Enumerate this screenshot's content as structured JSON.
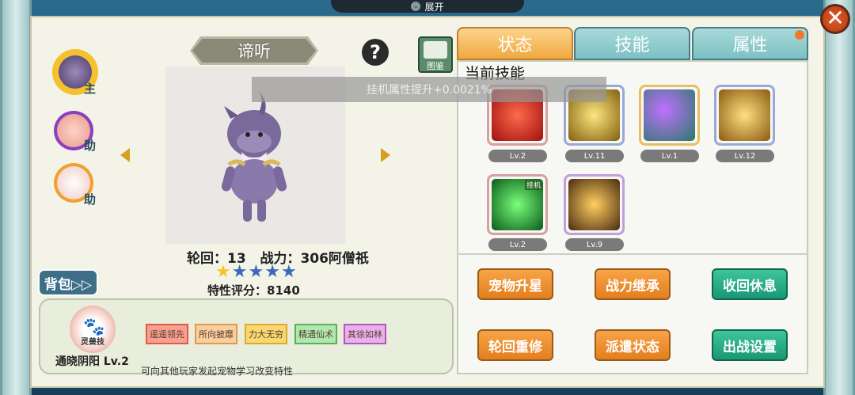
{
  "top_bar": {
    "expand_label": "展开"
  },
  "pet": {
    "name": "谛听",
    "reincarnation_label": "轮回：",
    "reincarnation": "13",
    "power_label": "战力：",
    "power": "306阿僧祇",
    "stars": 5,
    "trait_label": "特性评分：",
    "trait_score": "8140"
  },
  "team": [
    {
      "tag": "主",
      "role": "main"
    },
    {
      "tag": "助",
      "role": "assist"
    },
    {
      "tag": "助",
      "role": "assist"
    }
  ],
  "bag_label": "背包▷▷",
  "trait_box": {
    "emblem_text": "灵兽技",
    "pet_title": "通晓阴阳 Lv.2",
    "chips": [
      "遥遥领先",
      "所向披靡",
      "力大无穷",
      "精通仙术",
      "其徐如林"
    ],
    "chip_colors": [
      "#f07060",
      "#f4b070",
      "#f7c840",
      "#7ad07a",
      "#d07ad8"
    ],
    "description": "可向其他玩家发起宠物学习改变特性"
  },
  "tujian_label": "图鉴",
  "tabs": [
    {
      "label": "状态",
      "active": true
    },
    {
      "label": "技能",
      "active": false
    },
    {
      "label": "属性",
      "active": false
    }
  ],
  "current_skill_label": "当前技能",
  "toast": "挂机属性提升+0.0021%",
  "skills": [
    {
      "icon": "red-sword-skill-icon",
      "level": "Lv.2"
    },
    {
      "icon": "golden-crown-skill-icon",
      "level": "Lv.11"
    },
    {
      "icon": "purple-orb-cat-skill-icon",
      "level": "Lv.1"
    },
    {
      "icon": "golden-sword-skill-icon",
      "level": "Lv.12"
    },
    {
      "icon": "green-idle-skill-icon",
      "level": "Lv.2",
      "badge": "挂机"
    },
    {
      "icon": "golden-aura-skill-icon",
      "level": "Lv.9"
    }
  ],
  "actions": [
    {
      "label": "宠物升星",
      "color": "orange"
    },
    {
      "label": "战力继承",
      "color": "orange"
    },
    {
      "label": "收回休息",
      "color": "green"
    },
    {
      "label": "轮回重修",
      "color": "orange"
    },
    {
      "label": "派遣状态",
      "color": "orange"
    },
    {
      "label": "出战设置",
      "color": "green"
    }
  ]
}
